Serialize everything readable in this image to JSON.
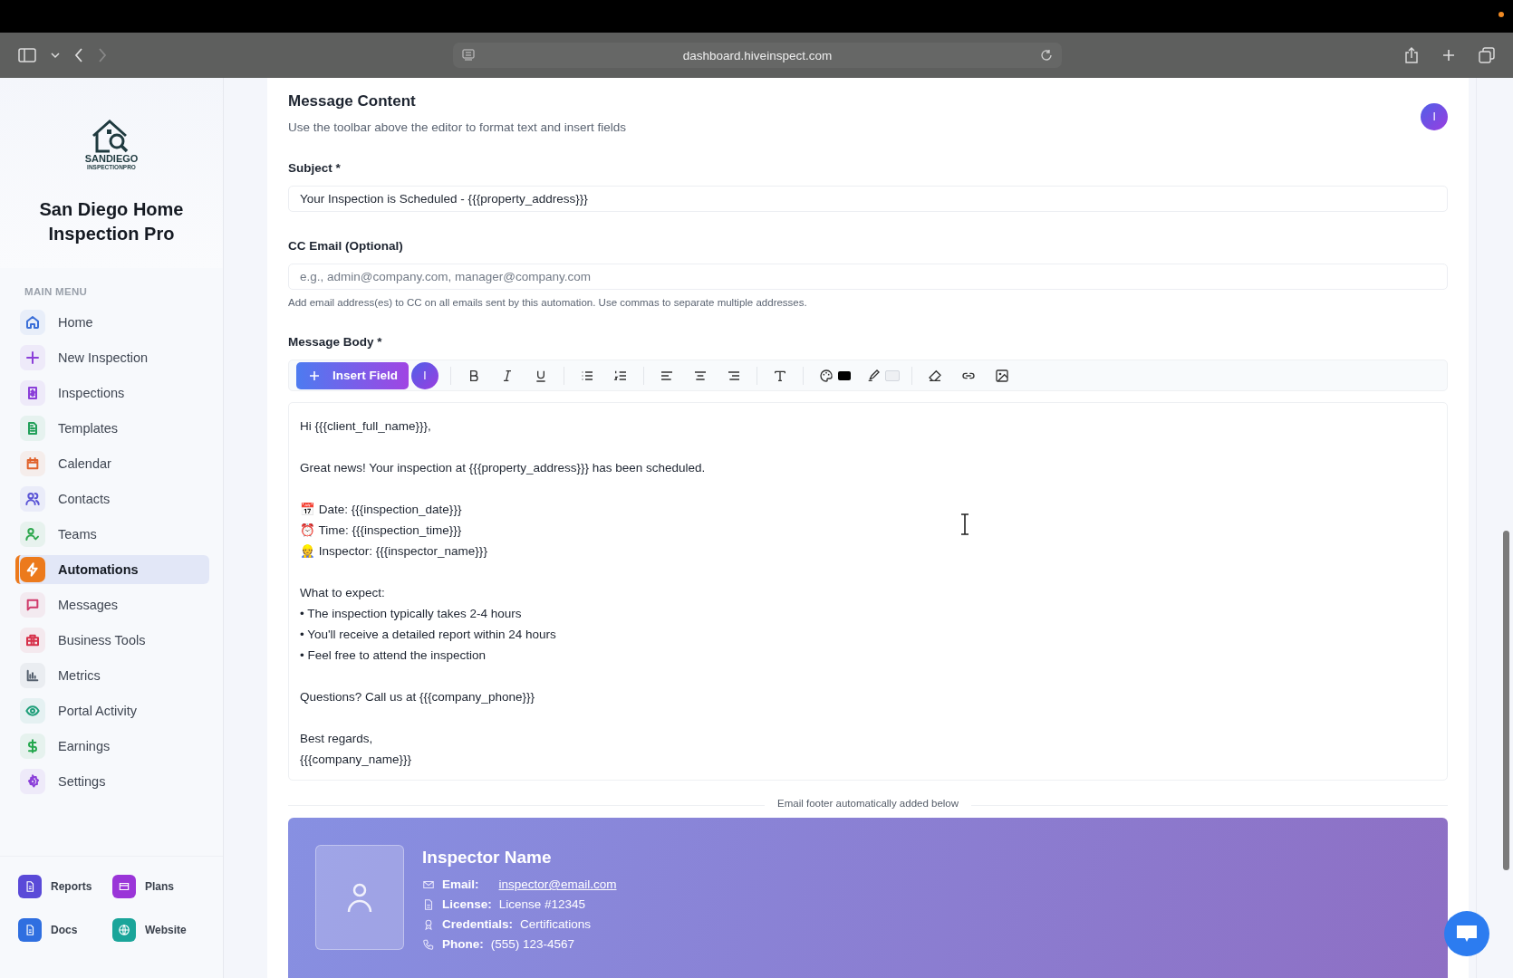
{
  "browser": {
    "url": "dashboard.hiveinspect.com"
  },
  "sidebar": {
    "logo_line1": "SANDIEGO",
    "logo_line2": "INSPECTIONPRO",
    "company": "San Diego Home Inspection Pro",
    "menu_heading": "MAIN MENU",
    "items": [
      {
        "label": "Home",
        "color": "#3b6fd8",
        "selected": false
      },
      {
        "label": "New Inspection",
        "color": "#8b3fd9",
        "selected": false
      },
      {
        "label": "Inspections",
        "color": "#8b3fd9",
        "selected": false
      },
      {
        "label": "Templates",
        "color": "#22a05a",
        "selected": false
      },
      {
        "label": "Calendar",
        "color": "#e0612a",
        "selected": false
      },
      {
        "label": "Contacts",
        "color": "#5b55d6",
        "selected": false
      },
      {
        "label": "Teams",
        "color": "#2fa84f",
        "selected": false
      },
      {
        "label": "Automations",
        "color": "#ffffff",
        "selected": true
      },
      {
        "label": "Messages",
        "color": "#d03a6a",
        "selected": false
      },
      {
        "label": "Business Tools",
        "color": "#d6304a",
        "selected": false
      },
      {
        "label": "Metrics",
        "color": "#55606e",
        "selected": false
      },
      {
        "label": "Portal Activity",
        "color": "#1f9f7a",
        "selected": false
      },
      {
        "label": "Earnings",
        "color": "#24a84e",
        "selected": false
      },
      {
        "label": "Settings",
        "color": "#8b3fd9",
        "selected": false
      }
    ],
    "shortcuts": [
      {
        "label": "Reports",
        "color": "#5a4ad8"
      },
      {
        "label": "Plans",
        "color": "#9a35d8"
      },
      {
        "label": "Docs",
        "color": "#2f6fe0"
      },
      {
        "label": "Website",
        "color": "#1aa59a"
      }
    ]
  },
  "content": {
    "title": "Message Content",
    "subtitle": "Use the toolbar above the editor to format text and insert fields",
    "avatar_initial": "I",
    "subject": {
      "label": "Subject *",
      "value": "Your Inspection is Scheduled - {{{property_address}}}"
    },
    "cc": {
      "label": "CC Email (Optional)",
      "placeholder": "e.g., admin@company.com, manager@company.com",
      "hint": "Add email address(es) to CC on all emails sent by this automation. Use commas to separate multiple addresses."
    },
    "body_label": "Message Body *",
    "toolbar": {
      "insert_label": "Insert Field",
      "insert_initial": "I"
    },
    "body": [
      [
        "Hi {{{client_full_name}}},"
      ],
      [
        "Great news! Your inspection at {{{property_address}}} has been scheduled."
      ],
      [
        "📅 Date: {{{inspection_date}}}",
        "⏰ Time: {{{inspection_time}}}",
        "👷 Inspector: {{{inspector_name}}}"
      ],
      [
        "What to expect:",
        "• The inspection typically takes 2-4 hours",
        "• You'll receive a detailed report within 24 hours",
        "• Feel free to attend the inspection"
      ],
      [
        "Questions? Call us at {{{company_phone}}}"
      ],
      [
        "Best regards,",
        "{{{company_name}}}"
      ]
    ],
    "footer_note": "Email footer automatically added below",
    "footer": {
      "name": "Inspector Name",
      "rows": [
        {
          "kind": "link",
          "label": "Email:",
          "value": "inspector@email.com"
        },
        {
          "kind": "text",
          "label": "License:",
          "value": "License #12345"
        },
        {
          "kind": "text",
          "label": "Credentials:",
          "value": "Certifications"
        },
        {
          "kind": "text",
          "label": "Phone:",
          "value": "(555) 123-4567"
        }
      ]
    }
  }
}
